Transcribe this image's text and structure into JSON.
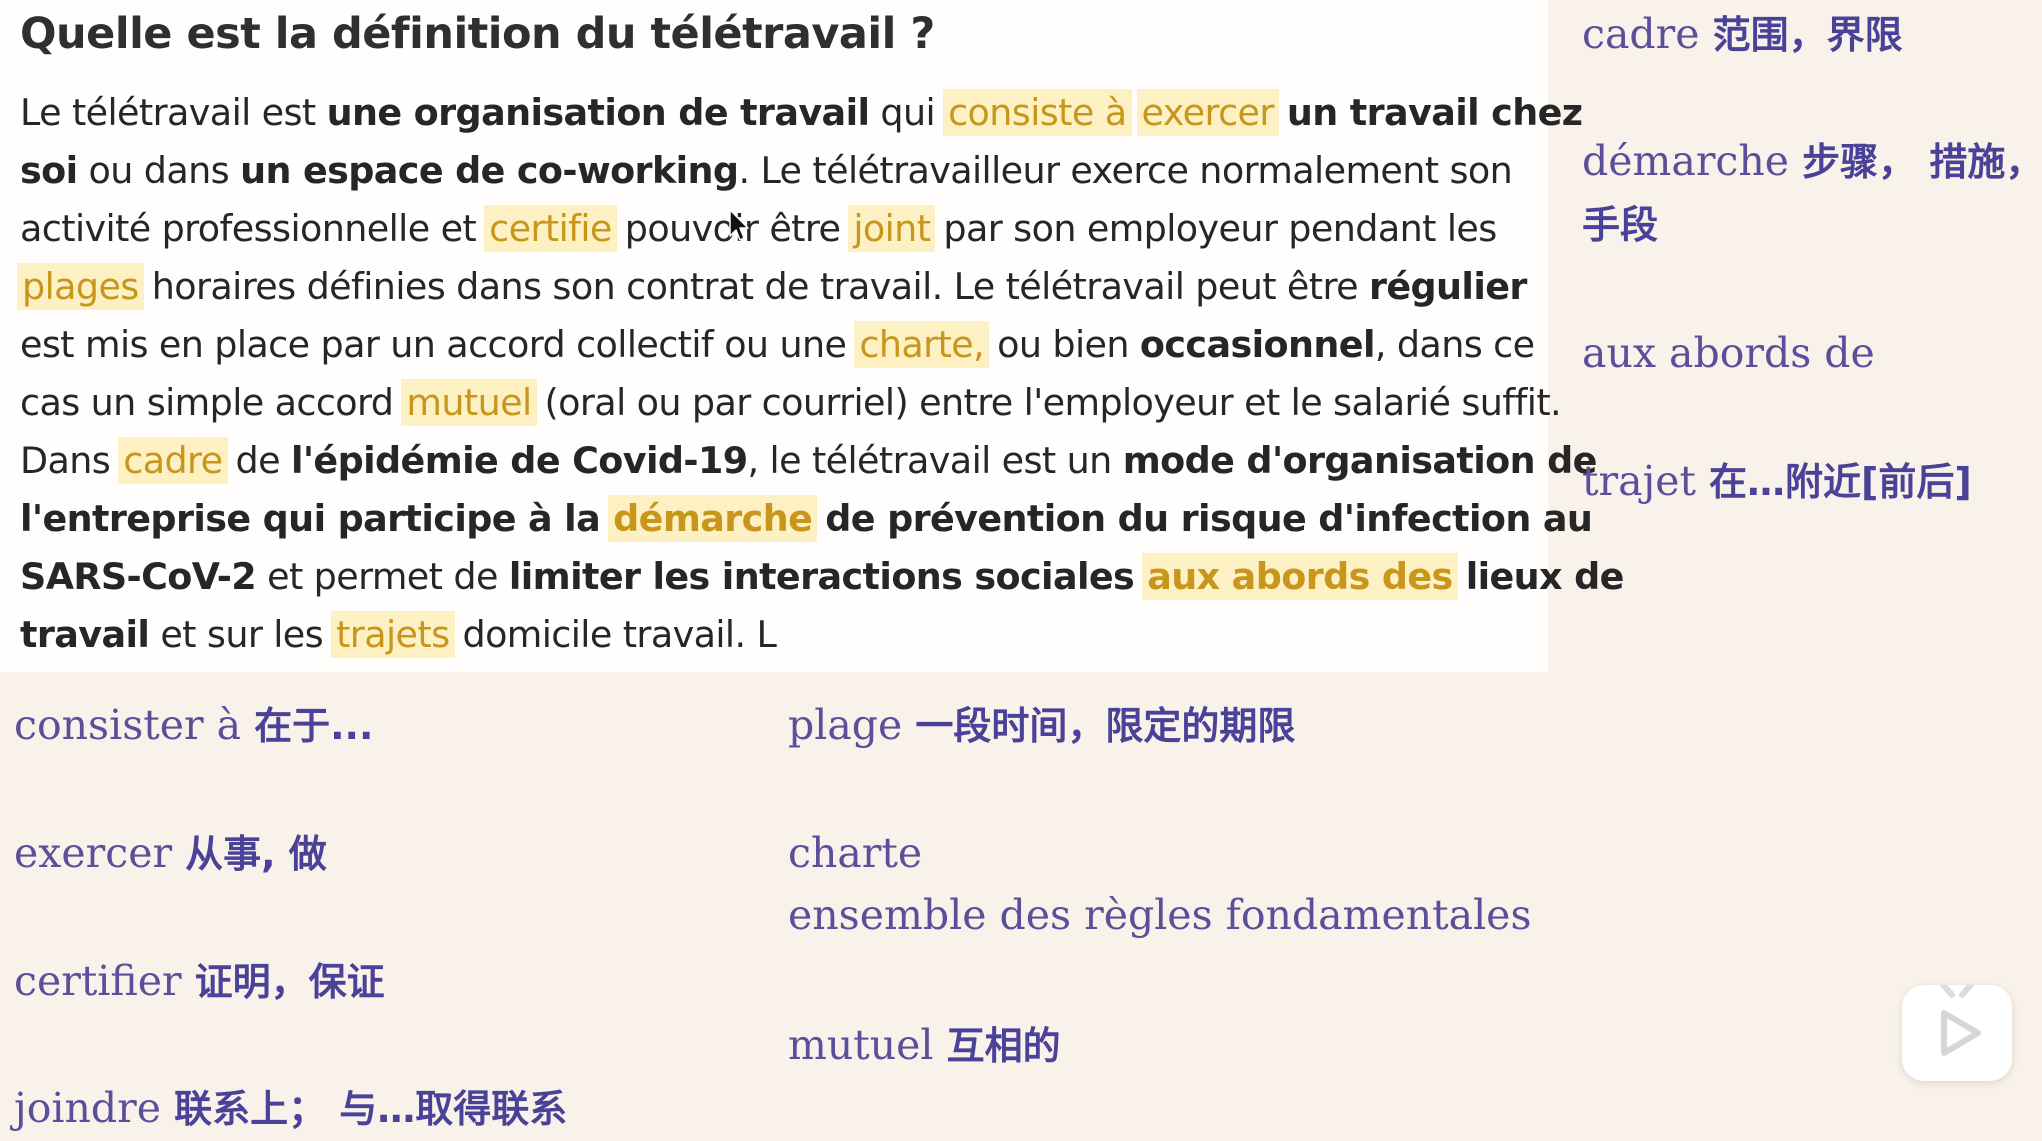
{
  "passage": {
    "title": "Quelle est la définition du télétravail ?",
    "lines": [
      [
        {
          "t": "Le télétravail est "
        },
        {
          "t": "une organisation de travail",
          "b": true
        },
        {
          "t": " qui "
        },
        {
          "t": "consiste à",
          "h": true
        },
        {
          "t": " "
        },
        {
          "t": "exercer",
          "h": true
        },
        {
          "t": " "
        },
        {
          "t": "un travail chez",
          "b": true
        }
      ],
      [
        {
          "t": "soi",
          "b": true
        },
        {
          "t": " ou dans "
        },
        {
          "t": "un espace de co-working",
          "b": true
        },
        {
          "t": ". Le télétravailleur exerce normalement son"
        }
      ],
      [
        {
          "t": "activité professionnelle et "
        },
        {
          "t": "certifie",
          "h": true
        },
        {
          "t": " pouvoir être "
        },
        {
          "t": "joint",
          "h": true
        },
        {
          "t": " par son employeur pendant les"
        }
      ],
      [
        {
          "t": "plages",
          "h": true
        },
        {
          "t": " horaires définies dans son contrat de travail. Le télétravail peut être "
        },
        {
          "t": "régulier",
          "b": true
        }
      ],
      [
        {
          "t": "est mis en place par un accord collectif ou une "
        },
        {
          "t": "charte,",
          "h": true
        },
        {
          "t": " ou bien "
        },
        {
          "t": "occasionnel",
          "b": true
        },
        {
          "t": ", dans ce"
        }
      ],
      [
        {
          "t": "cas un simple accord "
        },
        {
          "t": "mutuel",
          "h": true
        },
        {
          "t": " (oral ou par courriel) entre l'employeur et le salarié suffit."
        }
      ],
      [
        {
          "t": "Dans "
        },
        {
          "t": "cadre",
          "h": true
        },
        {
          "t": " de "
        },
        {
          "t": "l'épidémie de Covid-19",
          "b": true
        },
        {
          "t": ", le télétravail est un "
        },
        {
          "t": "mode d'organisation de",
          "b": true
        }
      ],
      [
        {
          "t": "l'entreprise qui participe à la",
          "b": true
        },
        {
          "t": " "
        },
        {
          "t": "démarche",
          "h": true,
          "b": true
        },
        {
          "t": " "
        },
        {
          "t": "de prévention du risque d'infection au",
          "b": true
        }
      ],
      [
        {
          "t": "SARS-CoV-2",
          "b": true
        },
        {
          "t": " et permet de "
        },
        {
          "t": "limiter les interactions sociales",
          "b": true
        },
        {
          "t": " "
        },
        {
          "t": "aux abords des",
          "h": true,
          "b": true
        },
        {
          "t": " "
        },
        {
          "t": "lieux de",
          "b": true
        }
      ],
      [
        {
          "t": "travail",
          "b": true
        },
        {
          "t": " et sur les "
        },
        {
          "t": "trajets",
          "h": true
        },
        {
          "t": " domicile travail. L"
        }
      ]
    ]
  },
  "vocab_right": [
    {
      "term": "cadre",
      "def": "范围，界限"
    },
    {
      "term": "démarche",
      "def": "步骤， 措施，",
      "def2": "手段"
    },
    {
      "term": "aux abords de",
      "def": ""
    },
    {
      "term": "trajet",
      "def": "在…附近[前后]"
    }
  ],
  "vocab_bottom_left": [
    {
      "term": "consister à",
      "def": "在于..."
    },
    {
      "term": "exercer",
      "def": "从事, 做"
    },
    {
      "term": "certifier",
      "def": "证明，保证"
    },
    {
      "term": "joindre",
      "def": "联系上； 与…取得联系"
    }
  ],
  "vocab_bottom_right": [
    {
      "term": "plage",
      "def": "一段时间，限定的期限"
    },
    {
      "term": "charte",
      "def": "",
      "def2": "ensemble des règles fondamentales"
    },
    {
      "term": "mutuel",
      "def": "互相的"
    }
  ],
  "colors": {
    "background": "#f9f2ea",
    "card": "#fffefd",
    "highlight_bg": "#fdf1c4",
    "highlight_text": "#c9961c",
    "vocab_text": "#5a4f9a"
  },
  "icons": {
    "cursor": "mouse-pointer-icon",
    "play": "play-icon"
  }
}
